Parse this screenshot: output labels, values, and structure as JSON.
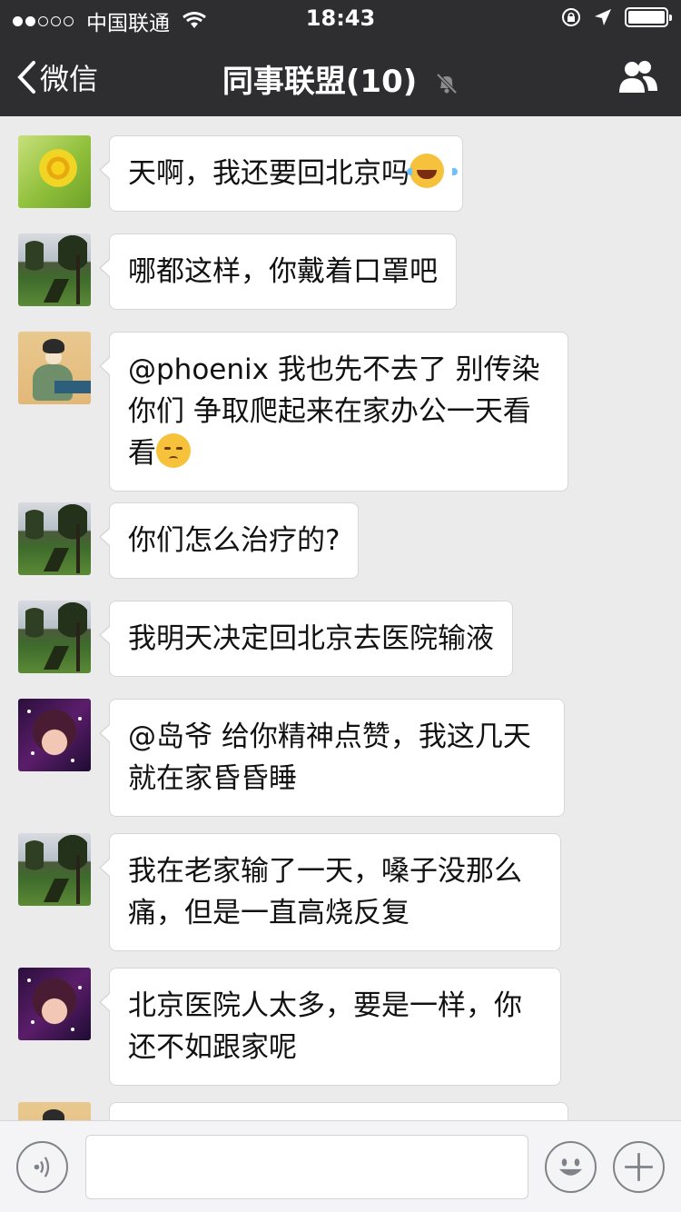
{
  "status_bar": {
    "signal_strength": "2 of 5",
    "carrier": "中国联通",
    "time": "18:43",
    "battery_level": 1.0,
    "icons": [
      "wifi-icon",
      "rotation-lock-icon",
      "location-arrow-icon",
      "battery-icon"
    ]
  },
  "nav": {
    "back_label": "微信",
    "title": "同事联盟(10)",
    "icons": [
      "chevron-left-icon",
      "mute-bell-icon",
      "group-members-icon"
    ]
  },
  "messages": [
    {
      "avatar": "sunflower",
      "text": "天啊，我还要回北京吗",
      "emoji": "tears-of-joy-emoji"
    },
    {
      "avatar": "park",
      "text": "哪都这样，你戴着口罩吧",
      "emoji": ""
    },
    {
      "avatar": "painting",
      "text_lines": [
        "@phoenix 我也先不去了 别传染",
        "你们 争取爬起来在家办公一天看",
        "看"
      ],
      "emoji": "pensive-emoji"
    },
    {
      "avatar": "park",
      "text": "你们怎么治疗的?",
      "emoji": ""
    },
    {
      "avatar": "park",
      "text": "我明天决定回北京去医院输液",
      "emoji": ""
    },
    {
      "avatar": "girl",
      "text_lines": [
        "@岛爷 给你精神点赞，我这几天",
        "就在家昏昏睡"
      ],
      "emoji": ""
    },
    {
      "avatar": "park",
      "text_lines": [
        "我在老家输了一天，嗓子没那么",
        "痛，但是一直高烧反复"
      ],
      "emoji": ""
    },
    {
      "avatar": "girl",
      "text_lines": [
        "北京医院人太多，要是一样，你",
        "还不如跟家呢"
      ],
      "emoji": ""
    },
    {
      "avatar": "painting",
      "text": "",
      "emoji": ""
    }
  ],
  "input_bar": {
    "input_value": "",
    "icons": [
      "voice-icon",
      "smiley-icon",
      "plus-icon"
    ]
  },
  "colors": {
    "nav_bg": "#2e2e31",
    "chat_bg": "#ebebeb",
    "bubble_bg": "#ffffff"
  }
}
